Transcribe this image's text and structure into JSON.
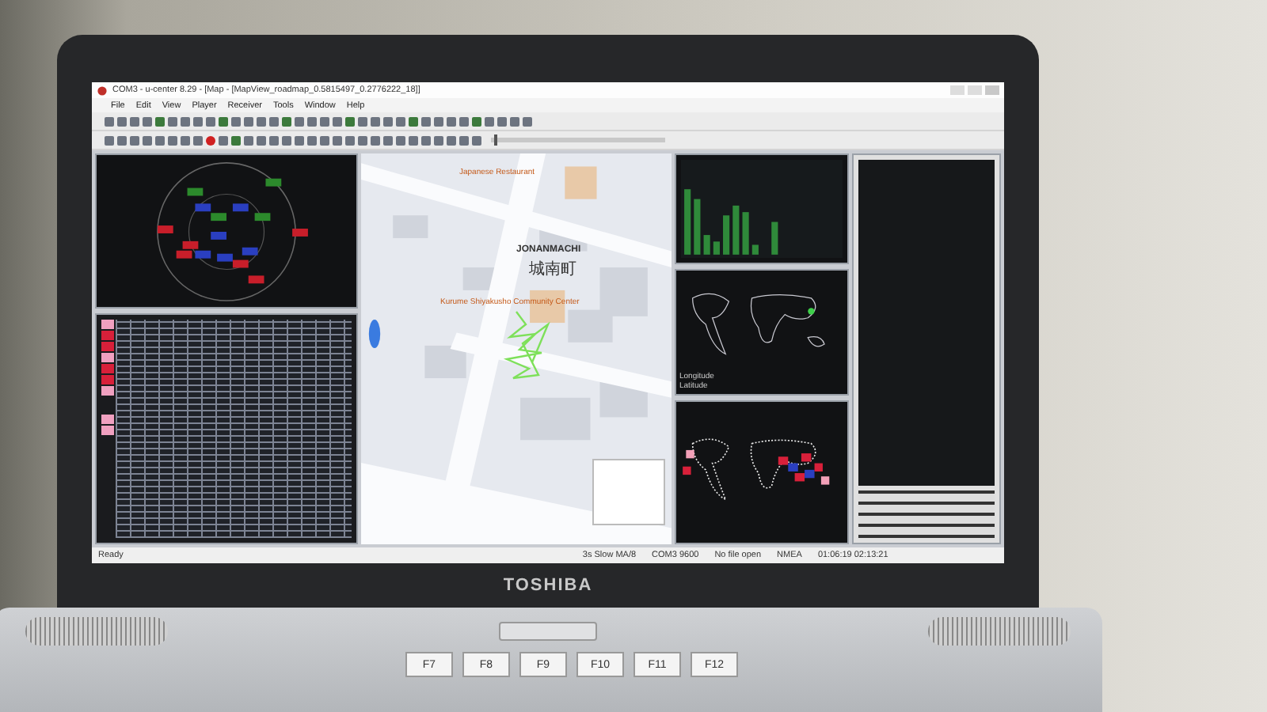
{
  "window": {
    "title": "COM3 - u-center 8.29 - [Map - [MapView_roadmap_0.5815497_0.2776222_18]]",
    "menu": [
      "File",
      "Edit",
      "View",
      "Player",
      "Receiver",
      "Tools",
      "Window",
      "Help"
    ]
  },
  "map": {
    "labels": [
      {
        "text": "Japanese Restaurant",
        "kind": "poi"
      },
      {
        "text": "JONANMACHI",
        "kind": "area"
      },
      {
        "text": "城南町",
        "kind": "area_local"
      },
      {
        "text": "Kurume Shiyakusho Community Center",
        "kind": "poi"
      }
    ]
  },
  "player": {
    "level": 0.02
  },
  "world_view": {
    "rows": [
      "Longitude",
      "Latitude"
    ]
  },
  "status_bar": [
    "Ready",
    "3s Slow MA/8",
    "COM3 9600",
    "No file open",
    "NMEA",
    "01:06:19 02:13:21"
  ],
  "brand": "TOSHIBA",
  "keys": [
    "F7",
    "F8",
    "F9",
    "F10",
    "F11",
    "F12"
  ]
}
